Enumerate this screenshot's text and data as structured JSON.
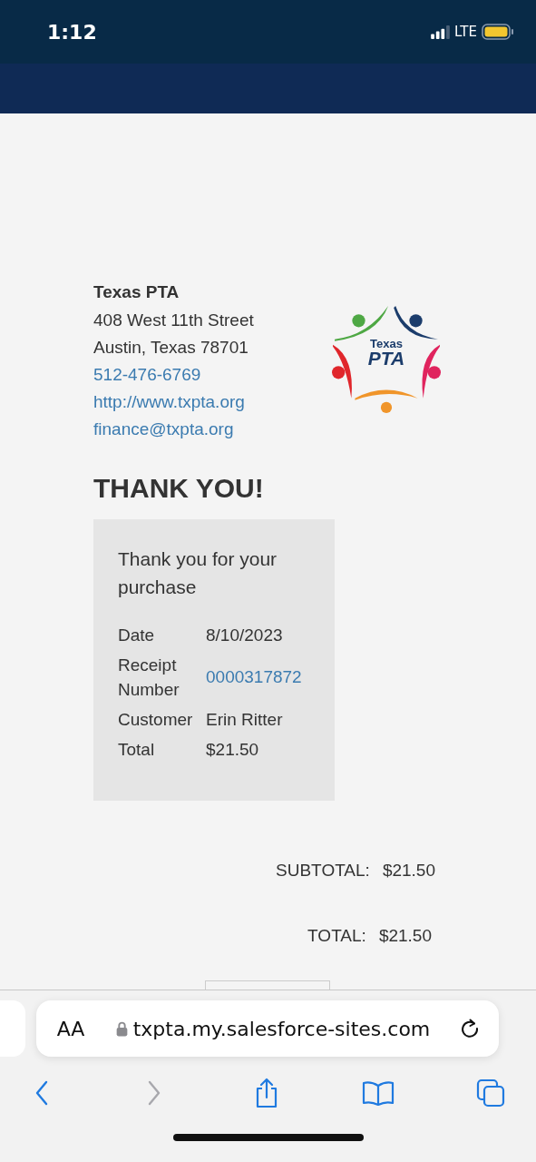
{
  "status_bar": {
    "time": "1:12",
    "network": "LTE"
  },
  "organization": {
    "name": "Texas PTA",
    "address_lines": [
      "408 West 11th Street",
      "Austin, Texas 78701"
    ],
    "links": [
      "512-476-6769",
      "http://www.txpta.org",
      "finance@txpta.org"
    ],
    "logo": {
      "word": "Texas",
      "acronym": "PTA"
    }
  },
  "heading": "THANK YOU!",
  "receipt_card": {
    "message": "Thank you for your purchase",
    "rows": [
      {
        "label": "Date",
        "value": "8/10/2023",
        "kind": "text"
      },
      {
        "label": "Receipt Number",
        "value": "0000317872",
        "kind": "link"
      },
      {
        "label": "Customer",
        "value": "Erin Ritter",
        "kind": "text"
      },
      {
        "label": "Total",
        "value": "$21.50",
        "kind": "text"
      }
    ]
  },
  "totals": [
    {
      "label": "SUBTOTAL:",
      "value": "$21.50"
    },
    {
      "label": "TOTAL:",
      "value": "$21.50"
    }
  ],
  "browser": {
    "text_size_label": "AA",
    "url": "txpta.my.salesforce-sites.com",
    "nav_buttons": [
      {
        "kind": "back",
        "disabled": false
      },
      {
        "kind": "forward",
        "disabled": true
      },
      {
        "kind": "share",
        "disabled": false
      },
      {
        "kind": "bookmarks",
        "disabled": false
      },
      {
        "kind": "tabs",
        "disabled": false
      }
    ]
  }
}
